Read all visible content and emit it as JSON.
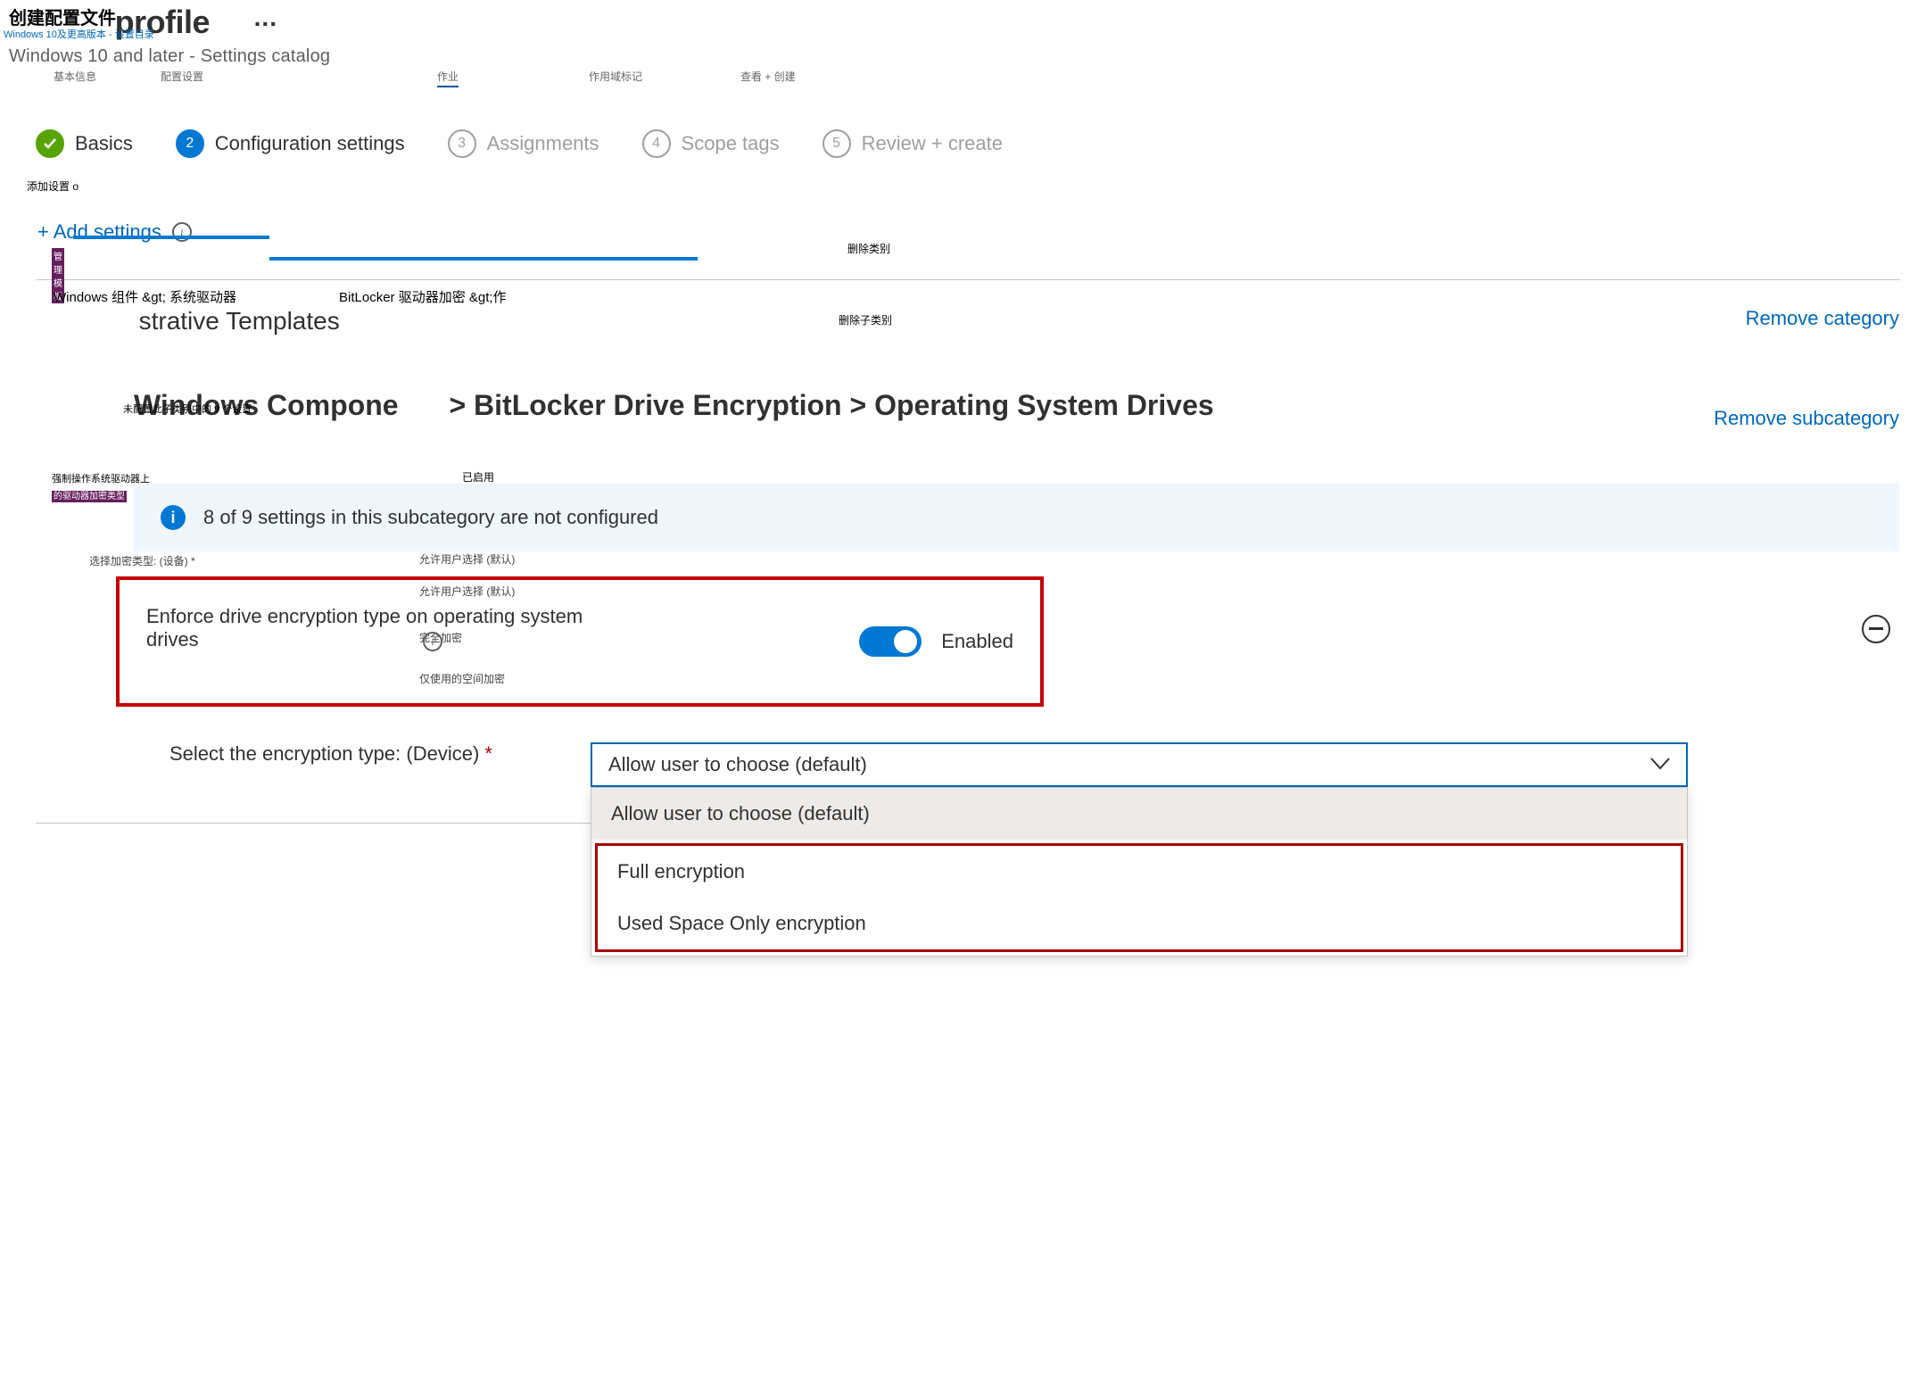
{
  "overlay": {
    "title_cn": "创建配置文件",
    "sub_cn": "Windows 10及更高版本 - 设置目录",
    "tab_basic": "基本信息",
    "tab_config": "配置设置",
    "tab_assign": "作业",
    "tab_scope": "作用域标记",
    "tab_review": "查看 + 创建",
    "add_settings_cn": "添加设置 o",
    "admin_template_cn": "管理模板",
    "win_comp_cn": "Windows 组件 &gt; 系统驱动器",
    "bitlocker_cn": "BitLocker 驱动器加密 &gt;作",
    "remove_cat_cn": "删除类别",
    "remove_sub_cn": "删除子类别",
    "unconfigured_cn": "未配置此子类别中的 9 个设置",
    "enforce_cn_l1": "强制操作系统驱动器上",
    "enforce_cn_l2": "的驱动器加密类型",
    "enabled_cn": "已启用",
    "select_type_cn": "选择加密类型: (设备) *",
    "opt0_cn": "允许用户选择 (默认)",
    "opt0b_cn": "允许用户选择 (默认)",
    "opt1_cn": "完全加密",
    "opt2_cn": "仅使用的空间加密"
  },
  "header": {
    "title_suffix": "profile",
    "ellipsis": "···",
    "subtitle": "Windows 10 and later - Settings catalog"
  },
  "wizard": {
    "step1": "Basics",
    "step2": "Configuration settings",
    "step3": "Assignments",
    "step4": "Scope tags",
    "step5": "Review + create",
    "n3": "3",
    "n4": "4",
    "n5": "5",
    "n2": "2"
  },
  "add_settings": "+ Add settings",
  "category": {
    "title": "Administrative Templates",
    "remove": "Remove category",
    "breadcrumb": "Windows Components > BitLocker Drive Encryption > Operating System Drives",
    "remove_sub": "Remove subcategory"
  },
  "info_banner": "8 of 9 settings in this subcategory are not configured",
  "setting": {
    "name": "Enforce drive encryption type on operating system drives",
    "state": "Enabled"
  },
  "select": {
    "label": "Select the encryption type: (Device)",
    "required": "*",
    "value": "Allow user to choose (default)",
    "options": [
      "Allow user to choose (default)",
      "Full encryption",
      "Used Space Only encryption"
    ]
  }
}
